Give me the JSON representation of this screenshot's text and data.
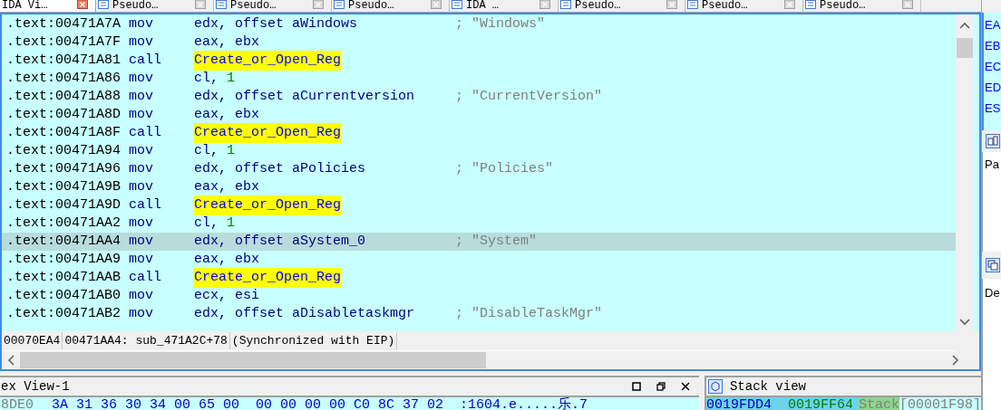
{
  "tabs": [
    {
      "label": "IDA Vi…",
      "selected": true
    },
    {
      "label": "Pseudo…",
      "selected": false
    },
    {
      "label": "Pseudo…",
      "selected": false
    },
    {
      "label": "Pseudo…",
      "selected": false
    },
    {
      "label": "IDA …",
      "selected": false
    },
    {
      "label": "Pseudo…",
      "selected": false
    },
    {
      "label": "Pseudo…",
      "selected": false
    },
    {
      "label": "Pseudo…",
      "selected": false
    }
  ],
  "listing": [
    {
      "address": ".text:00471A7A",
      "mnemonic": "mov",
      "operand": "edx, offset aWindows",
      "comment": "; \"Windows\"",
      "selected": false
    },
    {
      "address": ".text:00471A7F",
      "mnemonic": "mov",
      "operand": "eax, ebx",
      "selected": false
    },
    {
      "address": ".text:00471A81",
      "mnemonic": "call",
      "call_target": "Create_or_Open_Reg",
      "selected": false
    },
    {
      "address": ".text:00471A86",
      "mnemonic": "mov",
      "operand": "cl, ",
      "immediate": "1",
      "selected": false
    },
    {
      "address": ".text:00471A88",
      "mnemonic": "mov",
      "operand": "edx, offset aCurrentversion",
      "comment": "; \"CurrentVersion\"",
      "selected": false
    },
    {
      "address": ".text:00471A8D",
      "mnemonic": "mov",
      "operand": "eax, ebx",
      "selected": false
    },
    {
      "address": ".text:00471A8F",
      "mnemonic": "call",
      "call_target": "Create_or_Open_Reg",
      "selected": false
    },
    {
      "address": ".text:00471A94",
      "mnemonic": "mov",
      "operand": "cl, ",
      "immediate": "1",
      "selected": false
    },
    {
      "address": ".text:00471A96",
      "mnemonic": "mov",
      "operand": "edx, offset aPolicies",
      "comment": "; \"Policies\"",
      "selected": false
    },
    {
      "address": ".text:00471A9B",
      "mnemonic": "mov",
      "operand": "eax, ebx",
      "selected": false
    },
    {
      "address": ".text:00471A9D",
      "mnemonic": "call",
      "call_target": "Create_or_Open_Reg",
      "selected": false
    },
    {
      "address": ".text:00471AA2",
      "mnemonic": "mov",
      "operand": "cl, ",
      "immediate": "1",
      "selected": false
    },
    {
      "address": ".text:00471AA4",
      "mnemonic": "mov",
      "operand": "edx, offset aSystem_0",
      "comment": "; \"System\"",
      "selected": true
    },
    {
      "address": ".text:00471AA9",
      "mnemonic": "mov",
      "operand": "eax, ebx",
      "selected": false
    },
    {
      "address": ".text:00471AAB",
      "mnemonic": "call",
      "call_target": "Create_or_Open_Reg",
      "selected": false
    },
    {
      "address": ".text:00471AB0",
      "mnemonic": "mov",
      "operand": "ecx, esi",
      "selected": false
    },
    {
      "address": ".text:00471AB2",
      "mnemonic": "mov",
      "operand": "edx, offset aDisabletaskmgr",
      "comment": "; \"DisableTaskMgr\"",
      "selected": false
    }
  ],
  "status_bar": [
    "00070EA4",
    "00471AA4: sub_471A2C+78",
    "(Synchronized with EIP)"
  ],
  "hex_view": {
    "title": "ex View-1",
    "row": {
      "address": "8DE0",
      "bytes": "3A 31 36 30 34 00 65 00  00 00 00 00 C0 8C 37 02",
      "ascii": ":1604.e.....乐.7"
    }
  },
  "stack_view": {
    "title": "Stack view",
    "row": {
      "address": "0019FDD4",
      "value": "0019FF64",
      "label": "Stack",
      "suffix": "[00001F98]"
    }
  },
  "registers": [
    "EA",
    "EB",
    "EC",
    "ED",
    "ES"
  ],
  "side_panels": [
    "Pa",
    "De"
  ]
}
